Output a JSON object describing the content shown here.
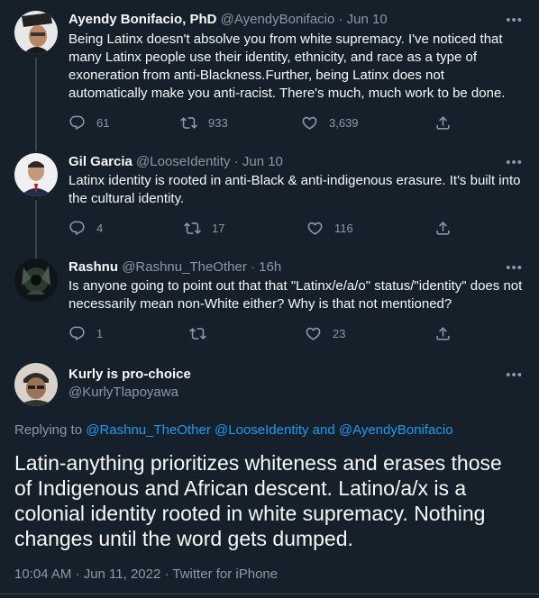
{
  "tweets": [
    {
      "display_name": "Ayendy Bonifacio, PhD",
      "handle": "@AyendyBonifacio",
      "date": "· Jun 10",
      "text": "Being Latinx doesn't absolve you from white supremacy. I've noticed that many Latinx people use their identity, ethnicity, and race as a type of exoneration from anti-Blackness.Further, being Latinx does not automatically make you anti-racist. There's much, much work to be done.",
      "replies": "61",
      "retweets": "933",
      "likes": "3,639"
    },
    {
      "display_name": "Gil Garcia",
      "handle": "@LooseIdentity",
      "date": "· Jun 10",
      "text": "Latinx identity is rooted in anti-Black & anti-indigenous erasure. It's built into the cultural identity.",
      "replies": "4",
      "retweets": "17",
      "likes": "116"
    },
    {
      "display_name": "Rashnu",
      "handle": "@Rashnu_TheOther",
      "date": "· 16h",
      "text": "Is anyone going to point out that that \"Latinx/e/a/o\" status/\"identity\" does not necessarily mean non-White either? Why is that not mentioned?",
      "replies": "1",
      "retweets": "",
      "likes": "23"
    }
  ],
  "focus": {
    "display_name": "Kurly is pro-choice",
    "handle": "@KurlyTlapoyawa",
    "replying_prefix": "Replying to",
    "mention_1": "@Rashnu_TheOther",
    "mention_2": "@LooseIdentity",
    "replying_and": "and",
    "mention_3": "@AyendyBonifacio",
    "text": "Latin-anything prioritizes whiteness and erases those of Indigenous and African descent. Latino/a/x is a colonial identity rooted in white supremacy. Nothing changes until the word gets dumped.",
    "timestamp": "10:04 AM · Jun 11, 2022 · Twitter for iPhone"
  },
  "icons": {
    "more": "more-icon",
    "reply": "reply-icon",
    "retweet": "retweet-icon",
    "like": "like-icon",
    "share": "share-icon"
  },
  "colors": {
    "background": "#15202b",
    "text": "#f7f9f9",
    "secondary": "#8b98a5",
    "link": "#1d9bf0",
    "line": "#38444d"
  }
}
